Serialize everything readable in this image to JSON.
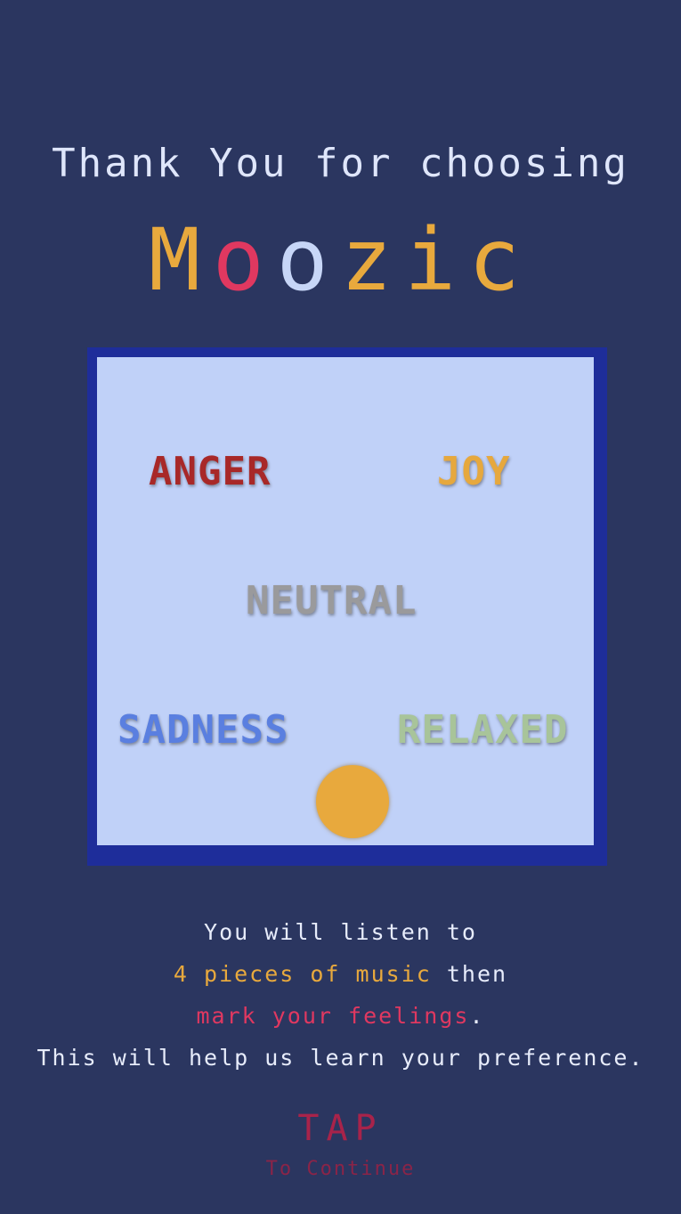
{
  "heading": "Thank You for choosing",
  "brand": {
    "letters": [
      {
        "ch": "M",
        "color": "#e8a93d"
      },
      {
        "ch": "o",
        "color": "#e03860"
      },
      {
        "ch": "o",
        "color": "#c7d6f7"
      },
      {
        "ch": "z",
        "color": "#e8a93d"
      },
      {
        "ch": "i",
        "color": "#e8a93d"
      },
      {
        "ch": "c",
        "color": "#e8a93d"
      }
    ]
  },
  "emotions": {
    "anger": {
      "label": "ANGER",
      "color": "#a82828"
    },
    "joy": {
      "label": "JOY",
      "color": "#e6a83e"
    },
    "neutral": {
      "label": "NEUTRAL",
      "color": "#9a9a9c"
    },
    "sadness": {
      "label": "SADNESS",
      "color": "#5a7fe0"
    },
    "relaxed": {
      "label": "RELAXED",
      "color": "#a8c49a"
    }
  },
  "marker": {
    "color": "#e8a93d"
  },
  "instructions": {
    "line1": "You will listen to",
    "line2_highlight": "4 pieces of music",
    "line2_rest": " then",
    "line3_highlight": "mark your feelings",
    "line3_rest": ".",
    "line4": "This will help us learn your preference.",
    "highlight_color_1": "#e8a93d",
    "highlight_color_2": "#e03860"
  },
  "tap": {
    "label": "TAP",
    "sub": "To Continue",
    "color": "#a8234a",
    "sub_color": "#8a2448"
  }
}
